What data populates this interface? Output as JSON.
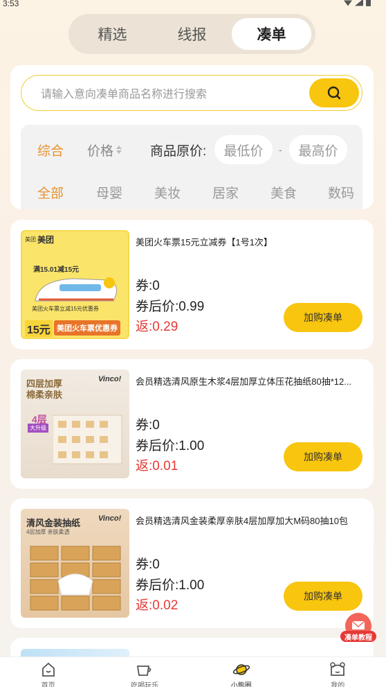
{
  "status_bar": {
    "time": "3:53"
  },
  "top_tabs": [
    {
      "label": "精选",
      "active": false
    },
    {
      "label": "线报",
      "active": false
    },
    {
      "label": "凑单",
      "active": true
    }
  ],
  "search": {
    "placeholder": "请输入意向凑单商品名称进行搜索"
  },
  "sort": {
    "default_label": "综合",
    "price_label": "价格",
    "original_price_label": "商品原价:",
    "min_placeholder": "最低价",
    "separator": "-",
    "max_placeholder": "最高价"
  },
  "categories": [
    "全部",
    "母婴",
    "美妆",
    "居家",
    "美食",
    "数码"
  ],
  "products": [
    {
      "title": "美团火车票15元立减券【1号1次】",
      "coupon": "券:0",
      "after_coupon": "券后价:0.99",
      "rebate": "返:0.29",
      "button": "加购凑单",
      "thumb_texts": [
        "美团",
        "美团",
        "满15.01减15元",
        "美团火车票立减15元优惠券",
        "15元",
        "美团火车票优惠券"
      ]
    },
    {
      "title": "会员精选清风原生木浆4层加厚立体压花抽纸80抽*12...",
      "coupon": "券:0",
      "after_coupon": "券后价:1.00",
      "rebate": "返:0.01",
      "button": "加购凑单",
      "thumb_texts": [
        "四层加厚",
        "棉柔亲肤",
        "Vinco!",
        "4层",
        "大升级"
      ]
    },
    {
      "title": "会员精选清风金装柔厚亲肤4层加厚加大M码80抽10包",
      "coupon": "券:0",
      "after_coupon": "券后价:1.00",
      "rebate": "返:0.02",
      "button": "加购凑单",
      "thumb_texts": [
        "清风金装抽纸",
        "4层加厚 亲肤柔透",
        "Vinco!"
      ]
    }
  ],
  "tutorial": {
    "label": "凑单教程"
  },
  "bottom_nav": [
    {
      "label": "首页",
      "icon": "home-icon",
      "active": false
    },
    {
      "label": "吃喝玩乐",
      "icon": "cup-icon",
      "active": false
    },
    {
      "label": "小熊圈",
      "icon": "planet-icon",
      "active": true
    },
    {
      "label": "我的",
      "icon": "bear-face-icon",
      "active": false
    }
  ],
  "colors": {
    "accent_yellow": "#f8c50f",
    "accent_orange": "#e7922d",
    "rebate_red": "#e53935"
  }
}
